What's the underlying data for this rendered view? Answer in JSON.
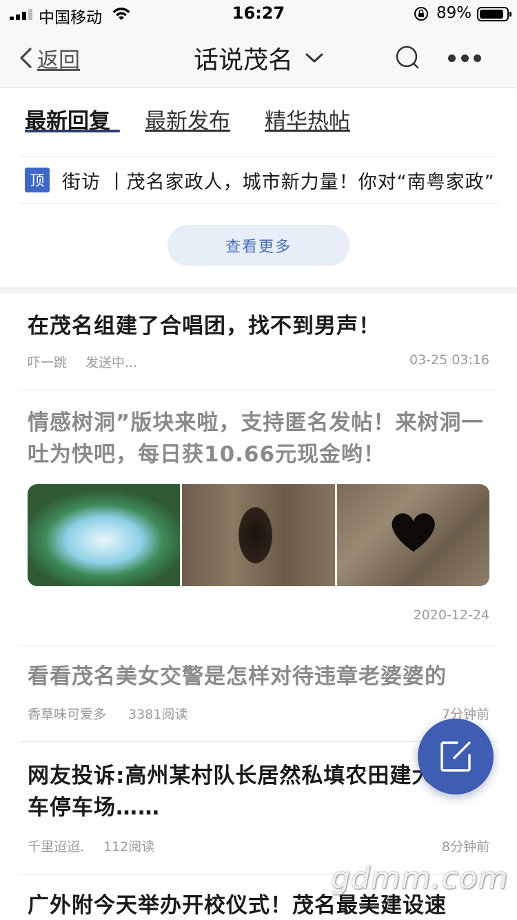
{
  "status_bar": {
    "carrier": "中国移动",
    "time": "16:27",
    "battery_percent": "89%",
    "battery_level": 0.89,
    "icons": [
      "signal-icon",
      "wifi-icon",
      "orientation-lock-icon",
      "battery-icon"
    ]
  },
  "nav": {
    "back_label": "返回",
    "title": "话说茂名",
    "icons": [
      "chevron-left-icon",
      "chevron-down-icon",
      "search-icon",
      "more-icon"
    ]
  },
  "tabs": [
    {
      "label": "最新回复",
      "active": true
    },
    {
      "label": "最新发布",
      "active": false
    },
    {
      "label": "精华热帖",
      "active": false
    }
  ],
  "pinned": {
    "badge": "顶",
    "text": "街访 丨茂名家政人，城市新力量！你对“南粤家政”"
  },
  "view_more_label": "查看更多",
  "posts": [
    {
      "title": "在茂名组建了合唱团，找不到男声！",
      "author": "吓一跳",
      "status": "发送中...",
      "time": "03-25 03:16"
    },
    {
      "title": "情感树洞”版块来啦，支持匿名发帖！来树洞一吐为快吧，每日获10.66元现金哟！",
      "date": "2020-12-24",
      "images": [
        "forest-frame-image",
        "tree-hollow-image",
        "heart-hollow-image"
      ]
    },
    {
      "title": "看看茂名美女交警是怎样对待违章老婆婆的",
      "author": "香草味可爱多",
      "reads": "3381阅读",
      "time": "7分钟前"
    },
    {
      "title": "网友投诉:高州某村队长居然私填农田建大型货车停车场……",
      "author": "千里迢迢.",
      "reads": "112阅读",
      "time": "8分钟前"
    },
    {
      "title": "广外附今天举办开校仪式！茂名最美建设速"
    }
  ],
  "watermark": "gdmm.com",
  "colors": {
    "accent": "#3f5eb3",
    "pin_badge": "#3d67c5",
    "view_more_bg": "#e8eef8",
    "view_more_text": "#4a6fb5"
  }
}
